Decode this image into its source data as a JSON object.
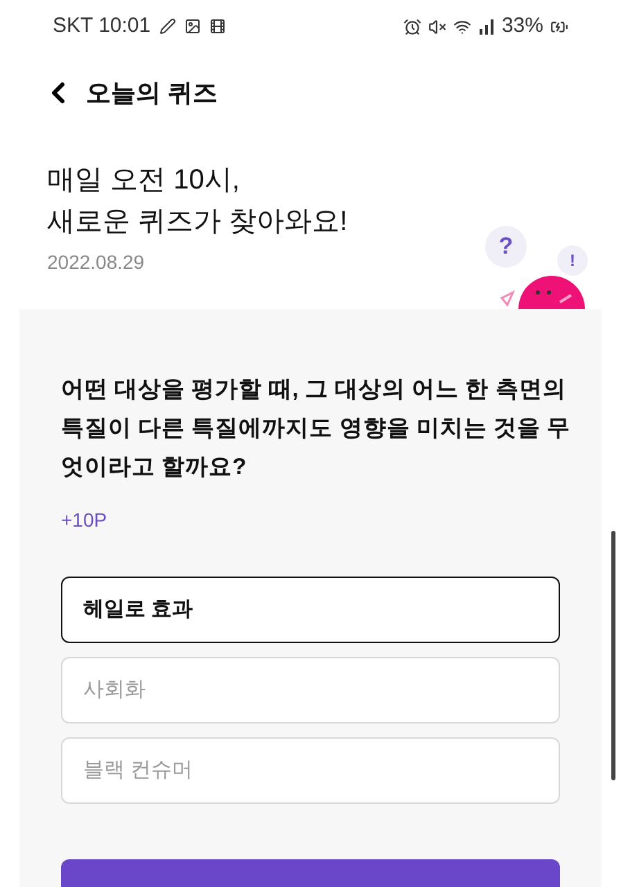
{
  "status_bar": {
    "carrier_time": "SKT 10:01",
    "battery": "33%"
  },
  "header": {
    "title": "오늘의 퀴즈"
  },
  "intro": {
    "headline_lines": [
      "매일 오전 10시,",
      "새로운 퀴즈가 찾아와요!"
    ],
    "date": "2022.08.29",
    "bubbles": [
      "?",
      "!"
    ]
  },
  "question": {
    "text": "어떤 대상을 평가할 때, 그 대상의 어느 한 측면의 특질이 다른 특질에까지도 영향을 미치는 것을 무엇이라고 할까요?",
    "points": "+10P"
  },
  "options": [
    {
      "label": "헤일로 효과",
      "selected": true
    },
    {
      "label": "사회화",
      "selected": false
    },
    {
      "label": "블랙 컨슈머",
      "selected": false
    }
  ]
}
